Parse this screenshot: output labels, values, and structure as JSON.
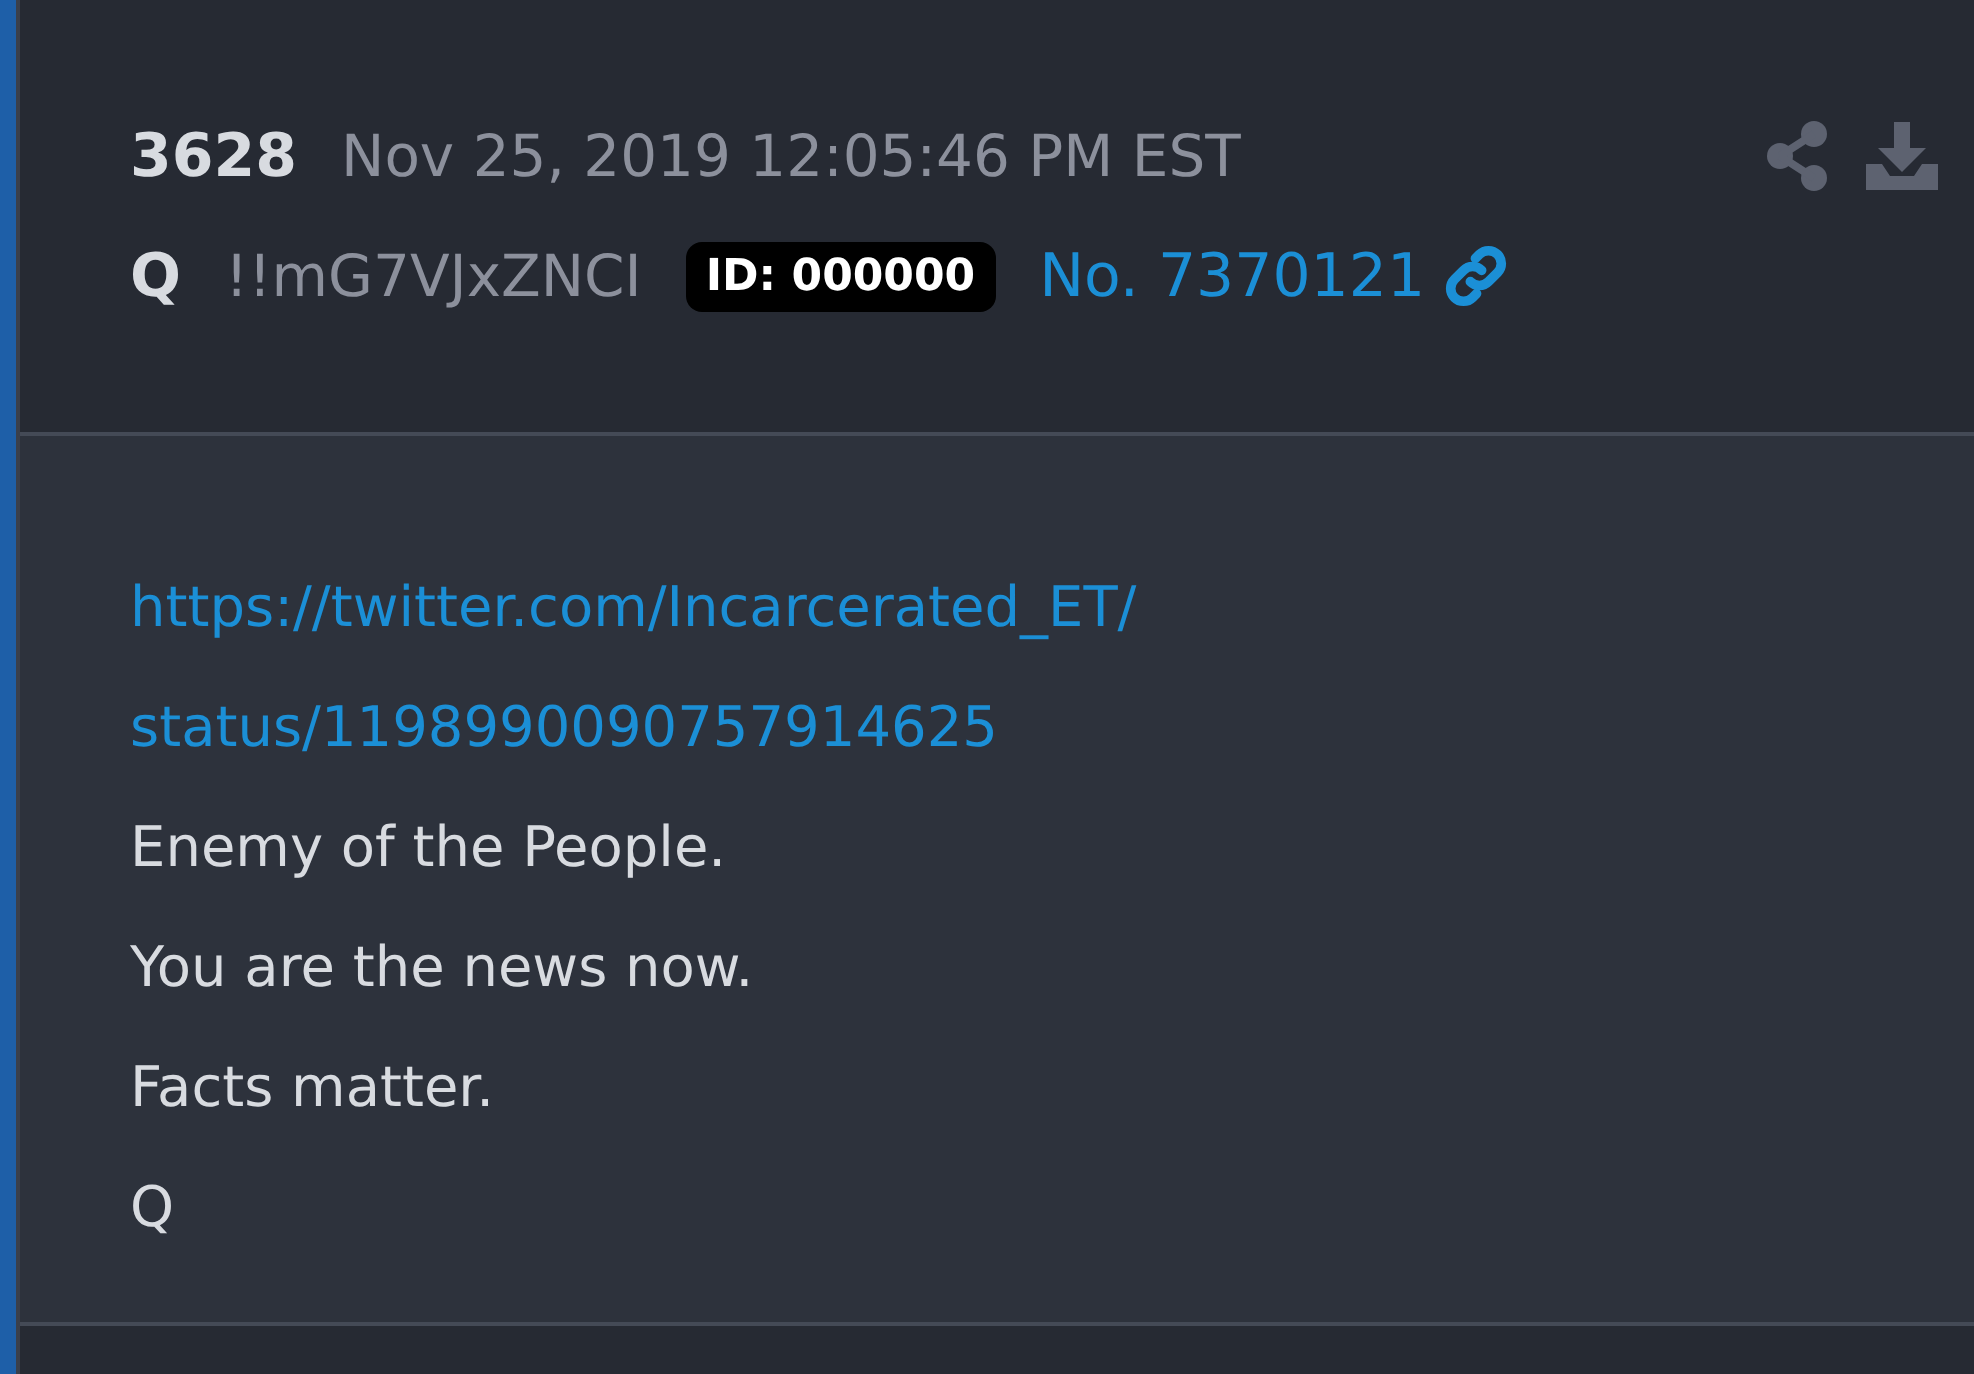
{
  "post": {
    "number": "3628",
    "timestamp": "Nov 25, 2019 12:05:46 PM EST",
    "author": "Q",
    "tripcode": "!!mG7VJxZNCI",
    "id_badge": "ID: 000000",
    "post_link": "No. 7370121",
    "body": [
      {
        "kind": "link",
        "text": "https://twitter.com/Incarcerated_ET/"
      },
      {
        "kind": "link",
        "text": "status/1198990090757914625"
      },
      {
        "kind": "text",
        "text": "Enemy of the People."
      },
      {
        "kind": "text",
        "text": "You are the news now."
      },
      {
        "kind": "text",
        "text": "Facts matter."
      },
      {
        "kind": "text",
        "text": "Q"
      }
    ]
  }
}
